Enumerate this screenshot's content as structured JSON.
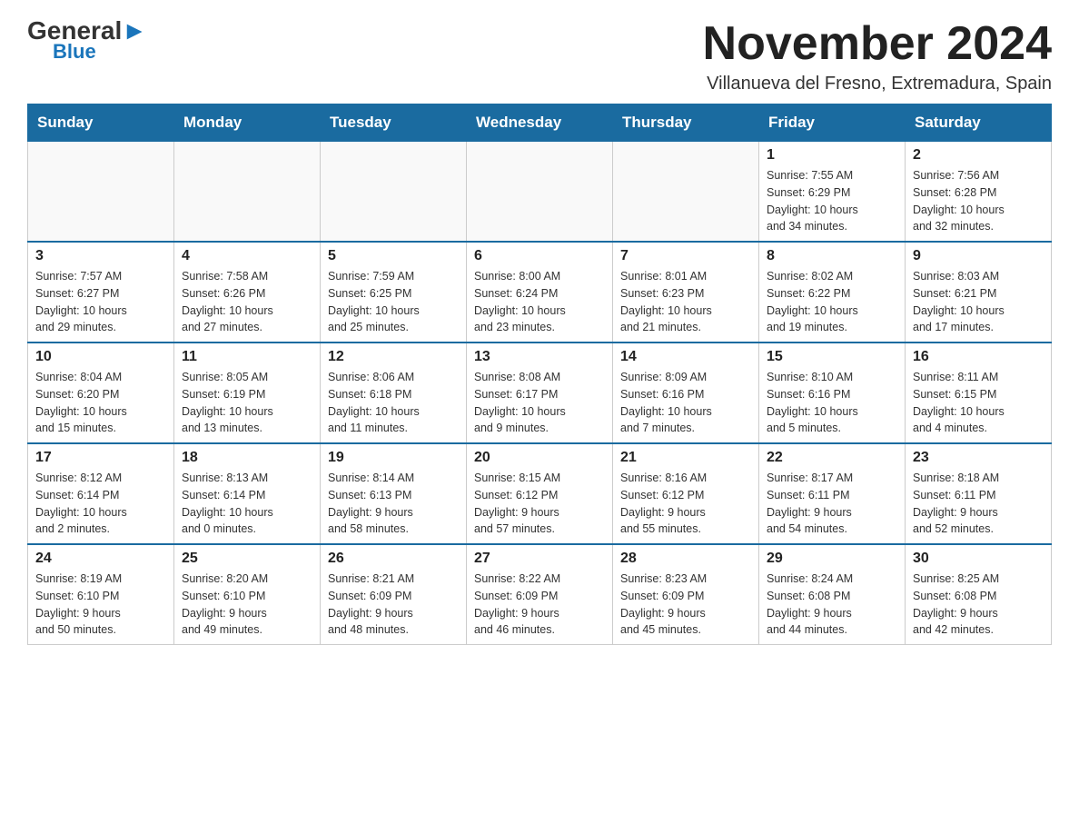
{
  "logo": {
    "general": "General",
    "triangle": "",
    "blue": "Blue"
  },
  "title": "November 2024",
  "location": "Villanueva del Fresno, Extremadura, Spain",
  "headers": [
    "Sunday",
    "Monday",
    "Tuesday",
    "Wednesday",
    "Thursday",
    "Friday",
    "Saturday"
  ],
  "weeks": [
    [
      {
        "day": "",
        "info": ""
      },
      {
        "day": "",
        "info": ""
      },
      {
        "day": "",
        "info": ""
      },
      {
        "day": "",
        "info": ""
      },
      {
        "day": "",
        "info": ""
      },
      {
        "day": "1",
        "info": "Sunrise: 7:55 AM\nSunset: 6:29 PM\nDaylight: 10 hours\nand 34 minutes."
      },
      {
        "day": "2",
        "info": "Sunrise: 7:56 AM\nSunset: 6:28 PM\nDaylight: 10 hours\nand 32 minutes."
      }
    ],
    [
      {
        "day": "3",
        "info": "Sunrise: 7:57 AM\nSunset: 6:27 PM\nDaylight: 10 hours\nand 29 minutes."
      },
      {
        "day": "4",
        "info": "Sunrise: 7:58 AM\nSunset: 6:26 PM\nDaylight: 10 hours\nand 27 minutes."
      },
      {
        "day": "5",
        "info": "Sunrise: 7:59 AM\nSunset: 6:25 PM\nDaylight: 10 hours\nand 25 minutes."
      },
      {
        "day": "6",
        "info": "Sunrise: 8:00 AM\nSunset: 6:24 PM\nDaylight: 10 hours\nand 23 minutes."
      },
      {
        "day": "7",
        "info": "Sunrise: 8:01 AM\nSunset: 6:23 PM\nDaylight: 10 hours\nand 21 minutes."
      },
      {
        "day": "8",
        "info": "Sunrise: 8:02 AM\nSunset: 6:22 PM\nDaylight: 10 hours\nand 19 minutes."
      },
      {
        "day": "9",
        "info": "Sunrise: 8:03 AM\nSunset: 6:21 PM\nDaylight: 10 hours\nand 17 minutes."
      }
    ],
    [
      {
        "day": "10",
        "info": "Sunrise: 8:04 AM\nSunset: 6:20 PM\nDaylight: 10 hours\nand 15 minutes."
      },
      {
        "day": "11",
        "info": "Sunrise: 8:05 AM\nSunset: 6:19 PM\nDaylight: 10 hours\nand 13 minutes."
      },
      {
        "day": "12",
        "info": "Sunrise: 8:06 AM\nSunset: 6:18 PM\nDaylight: 10 hours\nand 11 minutes."
      },
      {
        "day": "13",
        "info": "Sunrise: 8:08 AM\nSunset: 6:17 PM\nDaylight: 10 hours\nand 9 minutes."
      },
      {
        "day": "14",
        "info": "Sunrise: 8:09 AM\nSunset: 6:16 PM\nDaylight: 10 hours\nand 7 minutes."
      },
      {
        "day": "15",
        "info": "Sunrise: 8:10 AM\nSunset: 6:16 PM\nDaylight: 10 hours\nand 5 minutes."
      },
      {
        "day": "16",
        "info": "Sunrise: 8:11 AM\nSunset: 6:15 PM\nDaylight: 10 hours\nand 4 minutes."
      }
    ],
    [
      {
        "day": "17",
        "info": "Sunrise: 8:12 AM\nSunset: 6:14 PM\nDaylight: 10 hours\nand 2 minutes."
      },
      {
        "day": "18",
        "info": "Sunrise: 8:13 AM\nSunset: 6:14 PM\nDaylight: 10 hours\nand 0 minutes."
      },
      {
        "day": "19",
        "info": "Sunrise: 8:14 AM\nSunset: 6:13 PM\nDaylight: 9 hours\nand 58 minutes."
      },
      {
        "day": "20",
        "info": "Sunrise: 8:15 AM\nSunset: 6:12 PM\nDaylight: 9 hours\nand 57 minutes."
      },
      {
        "day": "21",
        "info": "Sunrise: 8:16 AM\nSunset: 6:12 PM\nDaylight: 9 hours\nand 55 minutes."
      },
      {
        "day": "22",
        "info": "Sunrise: 8:17 AM\nSunset: 6:11 PM\nDaylight: 9 hours\nand 54 minutes."
      },
      {
        "day": "23",
        "info": "Sunrise: 8:18 AM\nSunset: 6:11 PM\nDaylight: 9 hours\nand 52 minutes."
      }
    ],
    [
      {
        "day": "24",
        "info": "Sunrise: 8:19 AM\nSunset: 6:10 PM\nDaylight: 9 hours\nand 50 minutes."
      },
      {
        "day": "25",
        "info": "Sunrise: 8:20 AM\nSunset: 6:10 PM\nDaylight: 9 hours\nand 49 minutes."
      },
      {
        "day": "26",
        "info": "Sunrise: 8:21 AM\nSunset: 6:09 PM\nDaylight: 9 hours\nand 48 minutes."
      },
      {
        "day": "27",
        "info": "Sunrise: 8:22 AM\nSunset: 6:09 PM\nDaylight: 9 hours\nand 46 minutes."
      },
      {
        "day": "28",
        "info": "Sunrise: 8:23 AM\nSunset: 6:09 PM\nDaylight: 9 hours\nand 45 minutes."
      },
      {
        "day": "29",
        "info": "Sunrise: 8:24 AM\nSunset: 6:08 PM\nDaylight: 9 hours\nand 44 minutes."
      },
      {
        "day": "30",
        "info": "Sunrise: 8:25 AM\nSunset: 6:08 PM\nDaylight: 9 hours\nand 42 minutes."
      }
    ]
  ]
}
